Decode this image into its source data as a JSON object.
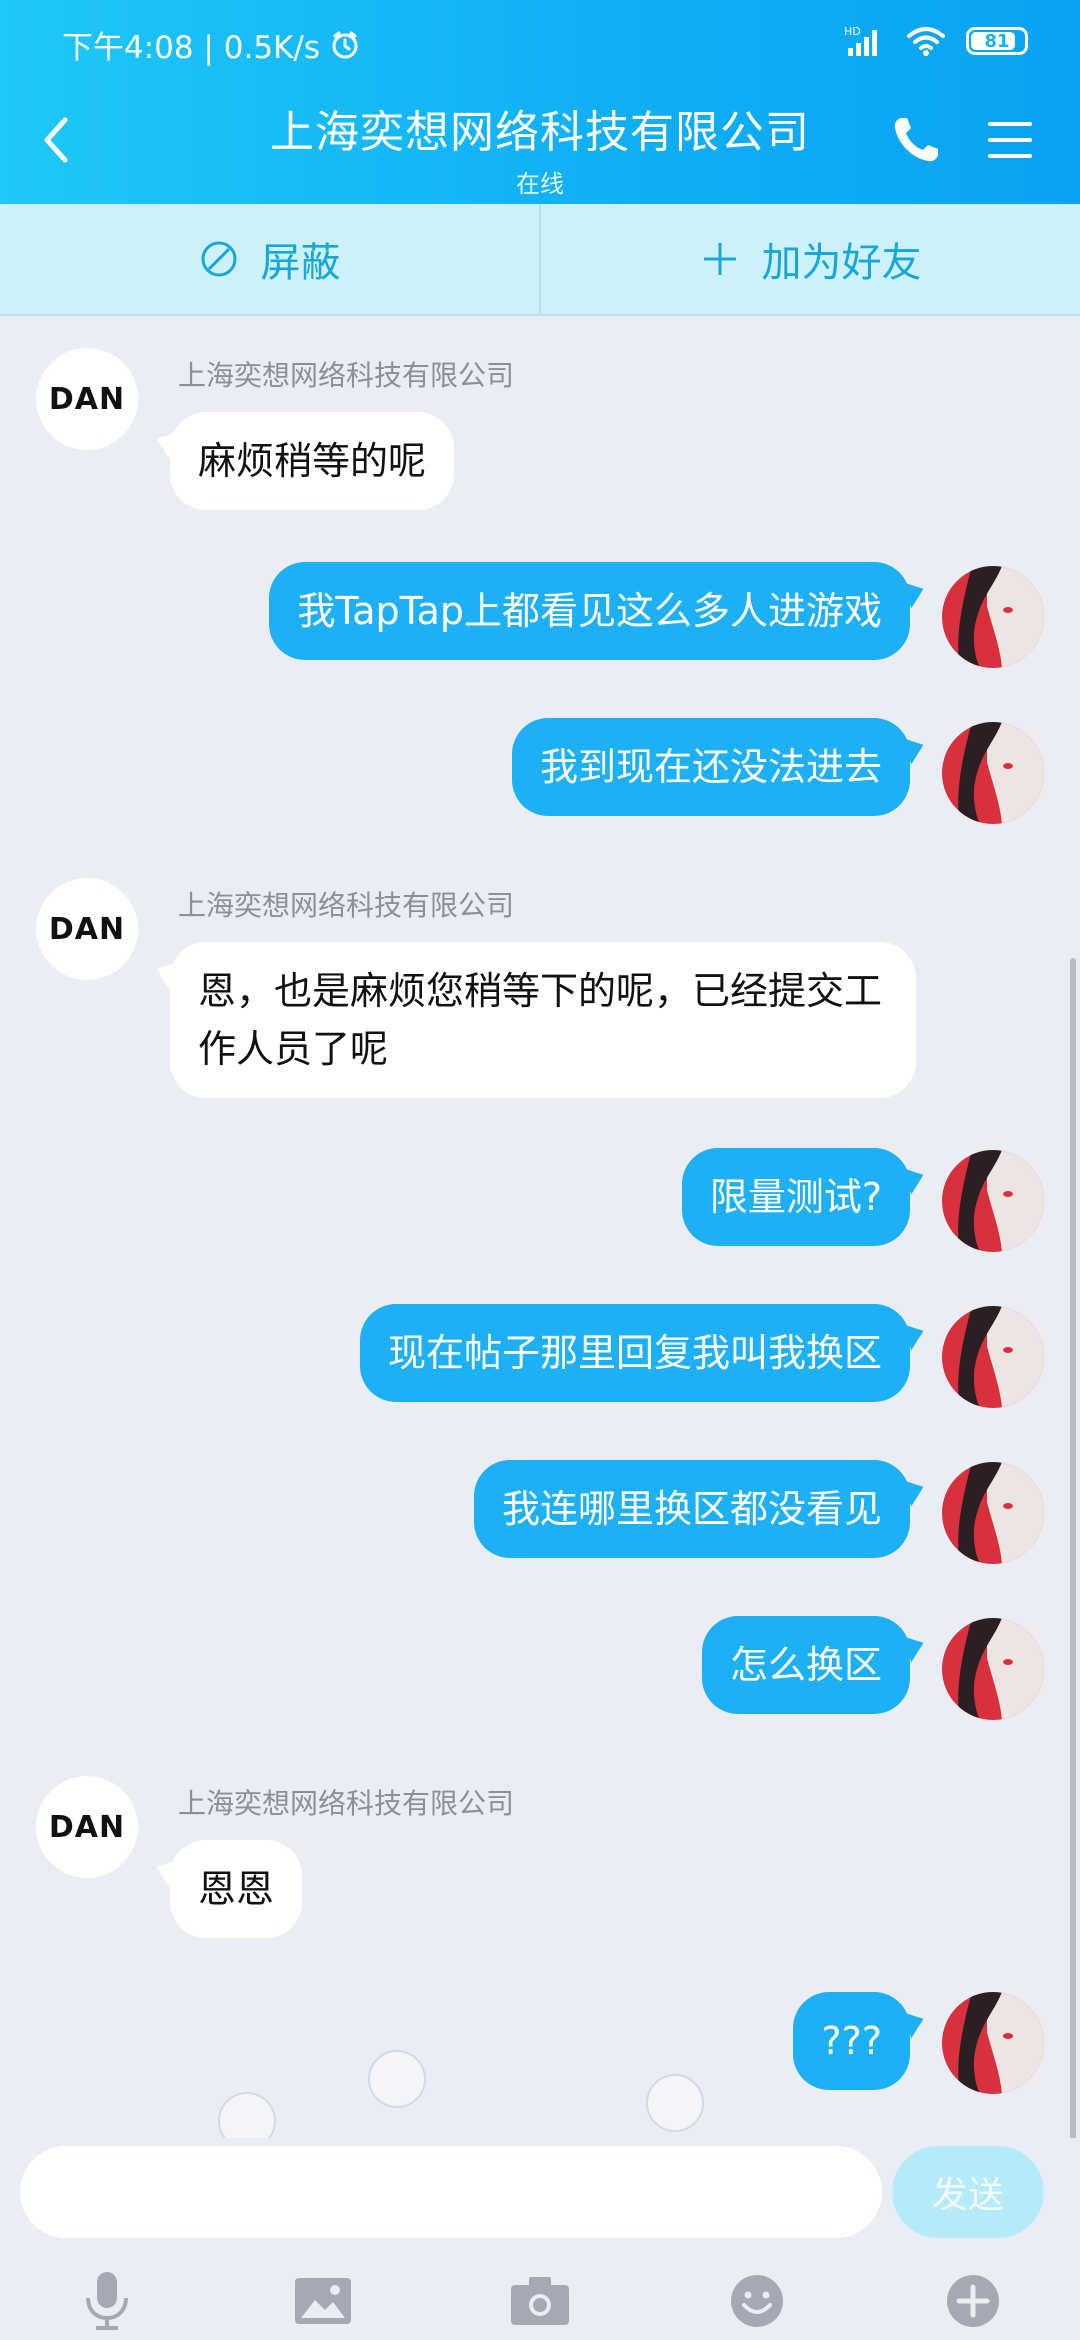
{
  "status": {
    "time_speed": "下午4:08 | 0.5K/s",
    "network": "HD",
    "battery": "81"
  },
  "header": {
    "title": "上海奕想网络科技有限公司",
    "subtitle": "在线"
  },
  "actions": {
    "block_label": "屏蔽",
    "add_friend_label": "加为好友"
  },
  "contact": {
    "name": "上海奕想网络科技有限公司",
    "avatar_text": "DAN"
  },
  "messages": [
    {
      "side": "in",
      "text": "麻烦稍等的呢"
    },
    {
      "side": "out",
      "text": "我TapTap上都看见这么多人进游戏"
    },
    {
      "side": "out",
      "text": "我到现在还没法进去"
    },
    {
      "side": "in",
      "text": "恩，也是麻烦您稍等下的呢，已经提交工作人员了呢"
    },
    {
      "side": "out",
      "text": "限量测试?"
    },
    {
      "side": "out",
      "text": "现在帖子那里回复我叫我换区"
    },
    {
      "side": "out",
      "text": "我连哪里换区都没看见"
    },
    {
      "side": "out",
      "text": "怎么换区"
    },
    {
      "side": "in",
      "text": "恩恩"
    },
    {
      "side": "out",
      "text": "???"
    }
  ],
  "input": {
    "value": "",
    "placeholder": "",
    "send_label": "发送"
  },
  "colors": {
    "header": "#10b0f5",
    "outgoing_bubble": "#1eb0f4",
    "incoming_bubble": "#ffffff",
    "background": "#eaedf4"
  },
  "icons": [
    "back-icon",
    "phone-icon",
    "menu-icon",
    "block-icon",
    "plus-icon",
    "mic-icon",
    "image-icon",
    "camera-icon",
    "emoji-icon",
    "add-icon"
  ]
}
